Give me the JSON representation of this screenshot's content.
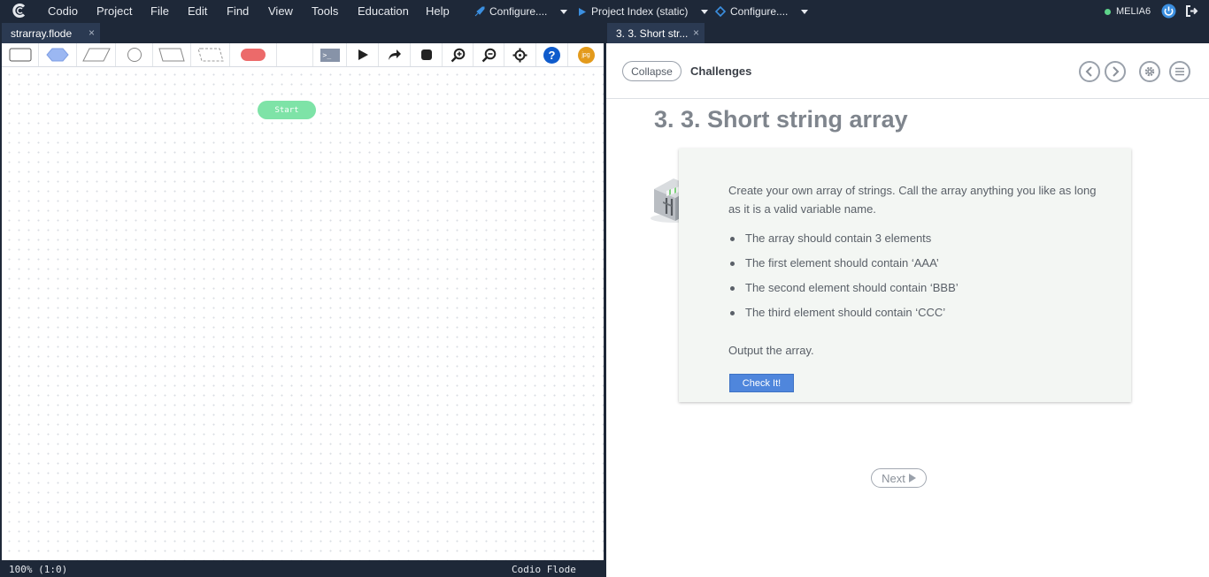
{
  "menubar": {
    "app_name": "Codio",
    "items": [
      "Project",
      "File",
      "Edit",
      "Find",
      "View",
      "Tools",
      "Education",
      "Help"
    ],
    "configure_1": "Configure....",
    "project_index": "Project Index (static)",
    "configure_2": "Configure....",
    "user": "MELIA6",
    "colors": {
      "bg": "#1e2838",
      "status_dot": "#5ed48a"
    }
  },
  "editor": {
    "tab_label": "strarray.flode",
    "tab_close": "×",
    "toolbar_icons": [
      "rectangle-shape-icon",
      "decision-shape-icon",
      "parallelogram-shape-icon",
      "circle-shape-icon",
      "trapezoid-shape-icon",
      "dashed-shape-icon",
      "terminal-shape-icon",
      "console-icon",
      "run-icon",
      "step-icon",
      "stop-icon",
      "zoom-in-icon",
      "zoom-out-icon",
      "center-icon",
      "help-icon",
      "export-jpg-icon"
    ],
    "console_glyph": ">_",
    "help_glyph": "?",
    "jpg_label": "jpg",
    "start_node": "Start",
    "status_zoom": "100% (1:0)",
    "status_name": "Codio Flode"
  },
  "guide": {
    "tab_label": "3. 3. Short str...",
    "tab_close": "×",
    "collapse_label": "Collapse",
    "header_title": "Challenges",
    "page_title": "3. 3. Short string array",
    "intro": "Create your own array of strings. Call the array anything you like as long as it is a valid variable name.",
    "bullets": [
      "The array should contain 3 elements",
      "The first element should contain ‘AAA’",
      "The second element should contain ‘BBB’",
      "The third element should contain ‘CCC’"
    ],
    "output_text": "Output the array.",
    "check_button": "Check It!",
    "next_button": "Next",
    "colors": {
      "accent": "#4f86dc",
      "card_bg": "#f3f6f3",
      "title": "#7f858d"
    }
  }
}
